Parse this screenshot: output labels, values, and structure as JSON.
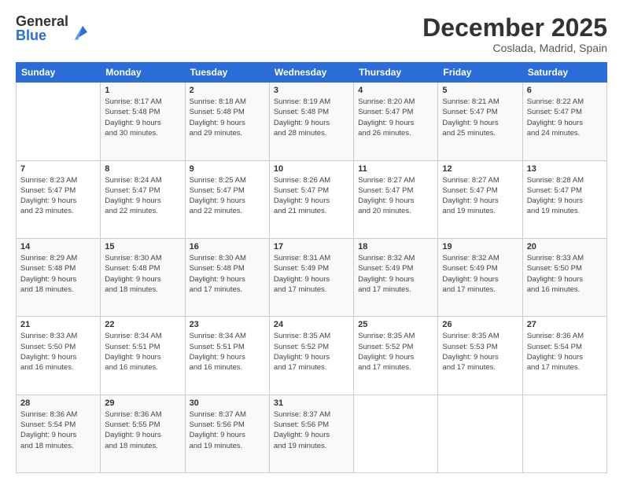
{
  "logo": {
    "general": "General",
    "blue": "Blue"
  },
  "header": {
    "month": "December 2025",
    "location": "Coslada, Madrid, Spain"
  },
  "weekdays": [
    "Sunday",
    "Monday",
    "Tuesday",
    "Wednesday",
    "Thursday",
    "Friday",
    "Saturday"
  ],
  "weeks": [
    [
      {
        "day": "",
        "info": ""
      },
      {
        "day": "1",
        "info": "Sunrise: 8:17 AM\nSunset: 5:48 PM\nDaylight: 9 hours\nand 30 minutes."
      },
      {
        "day": "2",
        "info": "Sunrise: 8:18 AM\nSunset: 5:48 PM\nDaylight: 9 hours\nand 29 minutes."
      },
      {
        "day": "3",
        "info": "Sunrise: 8:19 AM\nSunset: 5:48 PM\nDaylight: 9 hours\nand 28 minutes."
      },
      {
        "day": "4",
        "info": "Sunrise: 8:20 AM\nSunset: 5:47 PM\nDaylight: 9 hours\nand 26 minutes."
      },
      {
        "day": "5",
        "info": "Sunrise: 8:21 AM\nSunset: 5:47 PM\nDaylight: 9 hours\nand 25 minutes."
      },
      {
        "day": "6",
        "info": "Sunrise: 8:22 AM\nSunset: 5:47 PM\nDaylight: 9 hours\nand 24 minutes."
      }
    ],
    [
      {
        "day": "7",
        "info": "Sunrise: 8:23 AM\nSunset: 5:47 PM\nDaylight: 9 hours\nand 23 minutes."
      },
      {
        "day": "8",
        "info": "Sunrise: 8:24 AM\nSunset: 5:47 PM\nDaylight: 9 hours\nand 22 minutes."
      },
      {
        "day": "9",
        "info": "Sunrise: 8:25 AM\nSunset: 5:47 PM\nDaylight: 9 hours\nand 22 minutes."
      },
      {
        "day": "10",
        "info": "Sunrise: 8:26 AM\nSunset: 5:47 PM\nDaylight: 9 hours\nand 21 minutes."
      },
      {
        "day": "11",
        "info": "Sunrise: 8:27 AM\nSunset: 5:47 PM\nDaylight: 9 hours\nand 20 minutes."
      },
      {
        "day": "12",
        "info": "Sunrise: 8:27 AM\nSunset: 5:47 PM\nDaylight: 9 hours\nand 19 minutes."
      },
      {
        "day": "13",
        "info": "Sunrise: 8:28 AM\nSunset: 5:47 PM\nDaylight: 9 hours\nand 19 minutes."
      }
    ],
    [
      {
        "day": "14",
        "info": "Sunrise: 8:29 AM\nSunset: 5:48 PM\nDaylight: 9 hours\nand 18 minutes."
      },
      {
        "day": "15",
        "info": "Sunrise: 8:30 AM\nSunset: 5:48 PM\nDaylight: 9 hours\nand 18 minutes."
      },
      {
        "day": "16",
        "info": "Sunrise: 8:30 AM\nSunset: 5:48 PM\nDaylight: 9 hours\nand 17 minutes."
      },
      {
        "day": "17",
        "info": "Sunrise: 8:31 AM\nSunset: 5:49 PM\nDaylight: 9 hours\nand 17 minutes."
      },
      {
        "day": "18",
        "info": "Sunrise: 8:32 AM\nSunset: 5:49 PM\nDaylight: 9 hours\nand 17 minutes."
      },
      {
        "day": "19",
        "info": "Sunrise: 8:32 AM\nSunset: 5:49 PM\nDaylight: 9 hours\nand 17 minutes."
      },
      {
        "day": "20",
        "info": "Sunrise: 8:33 AM\nSunset: 5:50 PM\nDaylight: 9 hours\nand 16 minutes."
      }
    ],
    [
      {
        "day": "21",
        "info": "Sunrise: 8:33 AM\nSunset: 5:50 PM\nDaylight: 9 hours\nand 16 minutes."
      },
      {
        "day": "22",
        "info": "Sunrise: 8:34 AM\nSunset: 5:51 PM\nDaylight: 9 hours\nand 16 minutes."
      },
      {
        "day": "23",
        "info": "Sunrise: 8:34 AM\nSunset: 5:51 PM\nDaylight: 9 hours\nand 16 minutes."
      },
      {
        "day": "24",
        "info": "Sunrise: 8:35 AM\nSunset: 5:52 PM\nDaylight: 9 hours\nand 17 minutes."
      },
      {
        "day": "25",
        "info": "Sunrise: 8:35 AM\nSunset: 5:52 PM\nDaylight: 9 hours\nand 17 minutes."
      },
      {
        "day": "26",
        "info": "Sunrise: 8:35 AM\nSunset: 5:53 PM\nDaylight: 9 hours\nand 17 minutes."
      },
      {
        "day": "27",
        "info": "Sunrise: 8:36 AM\nSunset: 5:54 PM\nDaylight: 9 hours\nand 17 minutes."
      }
    ],
    [
      {
        "day": "28",
        "info": "Sunrise: 8:36 AM\nSunset: 5:54 PM\nDaylight: 9 hours\nand 18 minutes."
      },
      {
        "day": "29",
        "info": "Sunrise: 8:36 AM\nSunset: 5:55 PM\nDaylight: 9 hours\nand 18 minutes."
      },
      {
        "day": "30",
        "info": "Sunrise: 8:37 AM\nSunset: 5:56 PM\nDaylight: 9 hours\nand 19 minutes."
      },
      {
        "day": "31",
        "info": "Sunrise: 8:37 AM\nSunset: 5:56 PM\nDaylight: 9 hours\nand 19 minutes."
      },
      {
        "day": "",
        "info": ""
      },
      {
        "day": "",
        "info": ""
      },
      {
        "day": "",
        "info": ""
      }
    ]
  ]
}
